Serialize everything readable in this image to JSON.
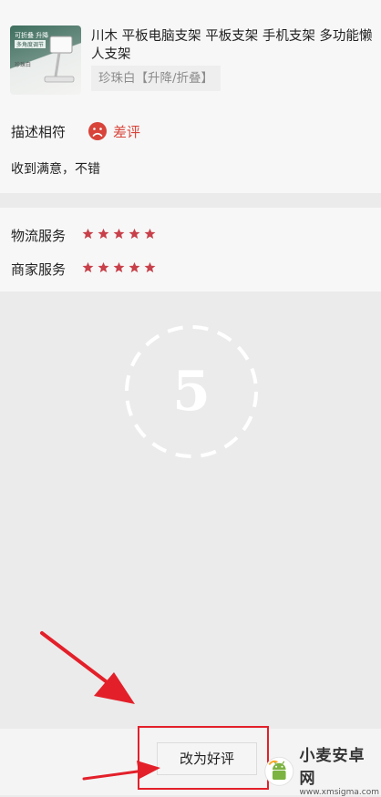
{
  "product": {
    "title": "川木 平板电脑支架 平板支架 手机支架 多功能懒人支架",
    "spec": "珍珠白【升降/折叠】",
    "thumbnail": {
      "line1": "可折叠 升降",
      "line2": "多角度调节",
      "line3": "珍珠白"
    }
  },
  "description": {
    "label": "描述相符",
    "rating_icon": "sad-face-icon",
    "rating_text": "差评",
    "rating_color": "#d8443a",
    "review": "收到满意，不错"
  },
  "service": {
    "logistics_label": "物流服务",
    "logistics_stars": 5,
    "merchant_label": "商家服务",
    "merchant_stars": 5,
    "star_color": "#c8404a"
  },
  "step_number": "5",
  "action": {
    "good_review_button": "改为好评"
  },
  "watermark": {
    "name": "小麦安卓网",
    "url": "www.xmsigma.com"
  },
  "annotation_color": "#e3202a"
}
